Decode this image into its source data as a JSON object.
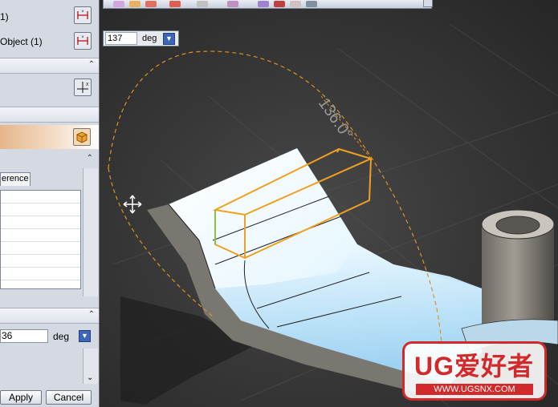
{
  "panel": {
    "selection_1_text": "1)",
    "selection_2_text": "Object (1)",
    "tab_reference_label": "erence",
    "angle_field_value": "36",
    "angle_field_unit": "deg",
    "apply_label": "Apply",
    "cancel_label": "Cancel"
  },
  "viewport": {
    "angle_input_value": "137",
    "angle_input_unit": "deg",
    "dimension_label": "136.0°",
    "watermark_title": "UG爱好者",
    "watermark_url": "WWW.UGSNX.COM"
  },
  "colors": {
    "selection_orange": "#f0a020",
    "sheet_highlight": "#e6f6ff",
    "panel_bg": "#d4d9e2",
    "watermark_red": "#d22a2a"
  },
  "icons": [
    "select-icon",
    "cube-icon",
    "dropdown-arrow-icon",
    "crosshair-cursor-icon",
    "chevron-up-icon",
    "chevron-down-icon"
  ]
}
